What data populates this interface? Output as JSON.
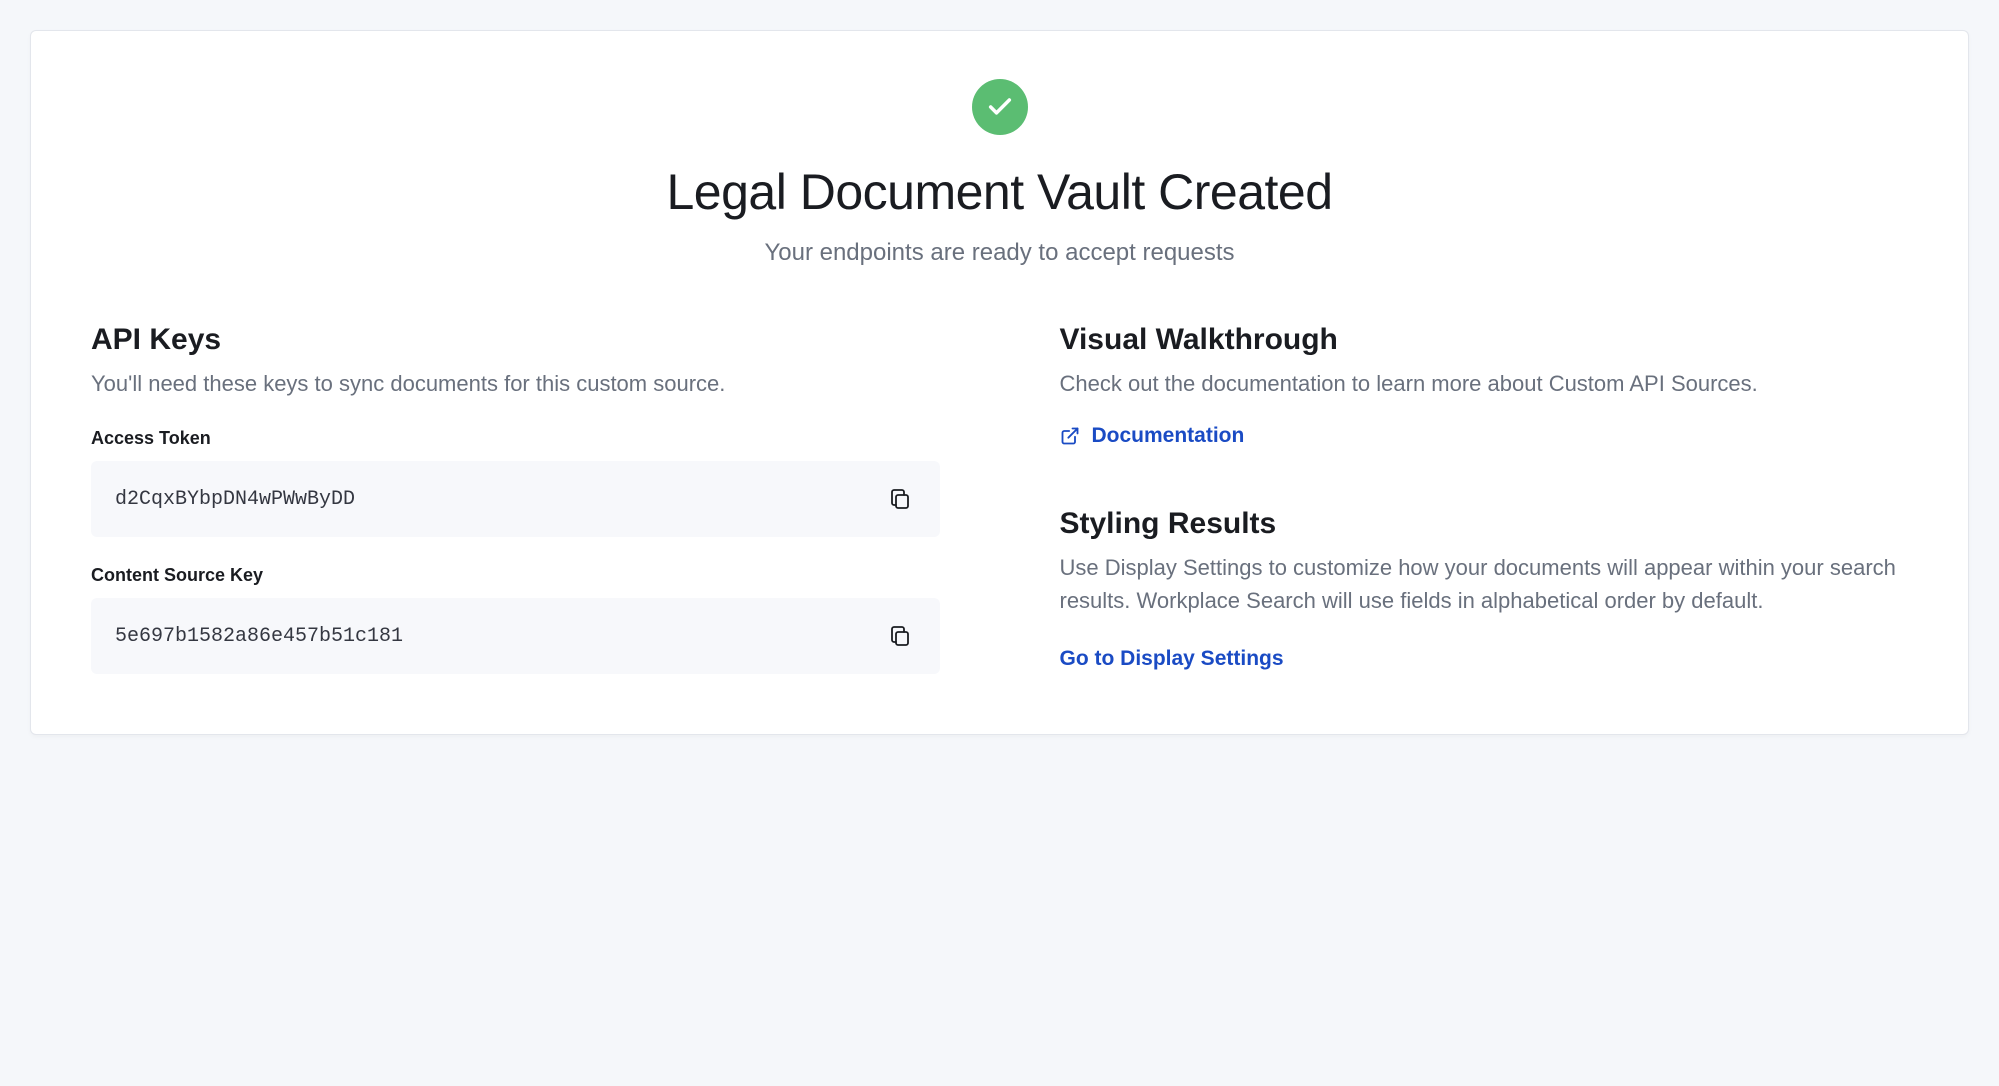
{
  "header": {
    "title": "Legal Document Vault Created",
    "subtitle": "Your endpoints are ready to accept requests"
  },
  "apiKeys": {
    "heading": "API Keys",
    "description": "You'll need these keys to sync documents for this custom source.",
    "accessTokenLabel": "Access Token",
    "accessTokenValue": "d2CqxBYbpDN4wPWwByDD",
    "contentSourceKeyLabel": "Content Source Key",
    "contentSourceKeyValue": "5e697b1582a86e457b51c181"
  },
  "walkthrough": {
    "heading": "Visual Walkthrough",
    "description": "Check out the documentation to learn more about Custom API Sources.",
    "linkLabel": "Documentation"
  },
  "styling": {
    "heading": "Styling Results",
    "description": "Use Display Settings to customize how your documents will appear within your search results. Workplace Search will use fields in alphabetical order by default.",
    "linkLabel": "Go to Display Settings"
  }
}
